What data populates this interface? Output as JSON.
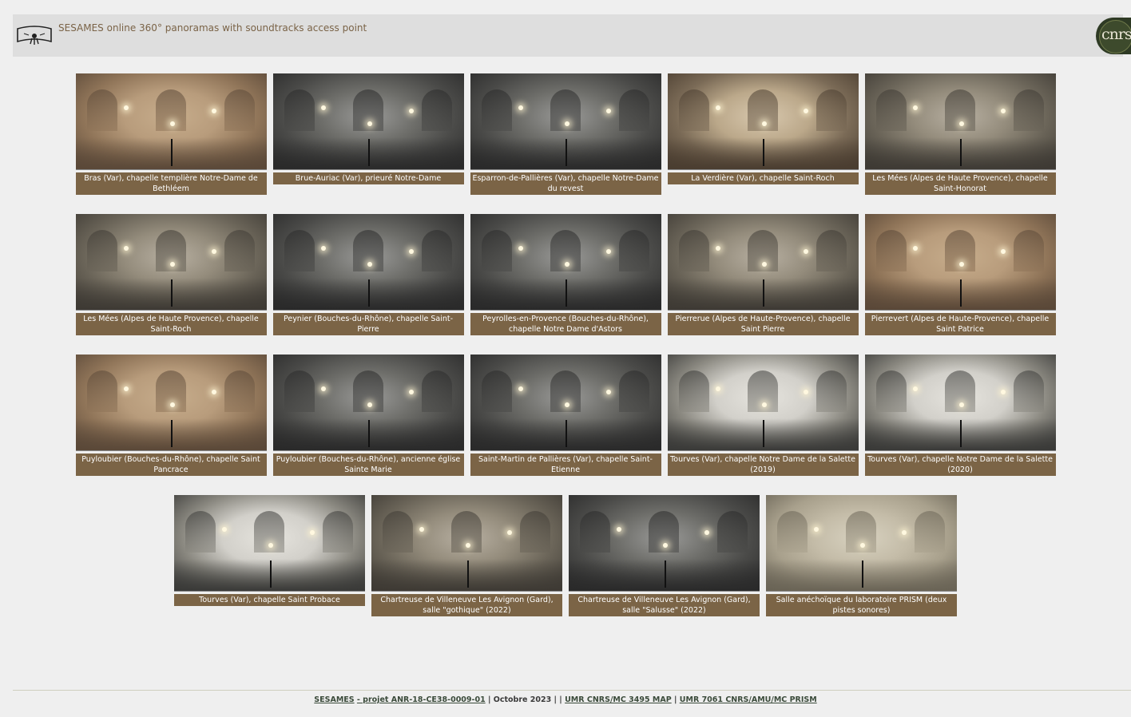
{
  "header": {
    "title": "SESAMES online 360° panoramas with soundtracks access point",
    "logo_icon": "panorama-hand-icon",
    "partner_logo_text": "cnrs"
  },
  "rows": [
    [
      {
        "caption": "Bras (Var), chapelle templière Notre-Dame de Bethléem",
        "tone": "warm"
      },
      {
        "caption": "Brue-Auriac (Var), prieuré Notre-Dame",
        "tone": "gray"
      },
      {
        "caption": "Esparron-de-Pallières (Var), chapelle Notre-Dame du revest",
        "tone": "gray"
      },
      {
        "caption": "La Verdière (Var), chapelle Saint-Roch",
        "tone": "beige"
      },
      {
        "caption": "Les Mées (Alpes de Haute Provence), chapelle Saint-Honorat",
        "tone": "stone"
      }
    ],
    [
      {
        "caption": "Les Mées (Alpes de Haute Provence), chapelle Saint-Roch",
        "tone": "stone"
      },
      {
        "caption": "Peynier (Bouches-du-Rhône), chapelle Saint-Pierre",
        "tone": "gray"
      },
      {
        "caption": "Peyrolles-en-Provence (Bouches-du-Rhône), chapelle Notre Dame d'Astors",
        "tone": "gray"
      },
      {
        "caption": "Pierrerue (Alpes de Haute-Provence), chapelle Saint Pierre",
        "tone": "stone"
      },
      {
        "caption": "Pierrevert (Alpes de Haute-Provence), chapelle Saint Patrice",
        "tone": "warm"
      }
    ],
    [
      {
        "caption": "Puyloubier (Bouches-du-Rhône), chapelle Saint Pancrace",
        "tone": "warm"
      },
      {
        "caption": "Puyloubier (Bouches-du-Rhône), ancienne église Sainte Marie",
        "tone": "gray"
      },
      {
        "caption": "Saint-Martin de Pallières (Var), chapelle Saint-Etienne",
        "tone": "gray"
      },
      {
        "caption": "Tourves (Var), chapelle Notre Dame de la Salette (2019)",
        "tone": "white"
      },
      {
        "caption": "Tourves (Var), chapelle Notre Dame de la Salette (2020)",
        "tone": "white"
      }
    ],
    [
      {
        "caption": "Tourves (Var), chapelle Saint Probace",
        "tone": "white"
      },
      {
        "caption": "Chartreuse de Villeneuve Les Avignon (Gard), salle \"gothique\" (2022)",
        "tone": "stone"
      },
      {
        "caption": "Chartreuse de Villeneuve Les Avignon (Gard), salle \"Salusse\" (2022)",
        "tone": "gray"
      },
      {
        "caption": "Salle anéchoïque du laboratoire PRISM (deux pistes sonores)",
        "tone": "anechoic"
      }
    ]
  ],
  "footer": {
    "sesames": "SESAMES",
    "project": "- projet ANR-18-CE38-0009-01",
    "sep1": " | Octobre 2023 | | ",
    "map": "UMR CNRS/MC 3495 MAP",
    "sep2": " | ",
    "prism": "UMR 7061 CNRS/AMU/MC PRISM"
  }
}
